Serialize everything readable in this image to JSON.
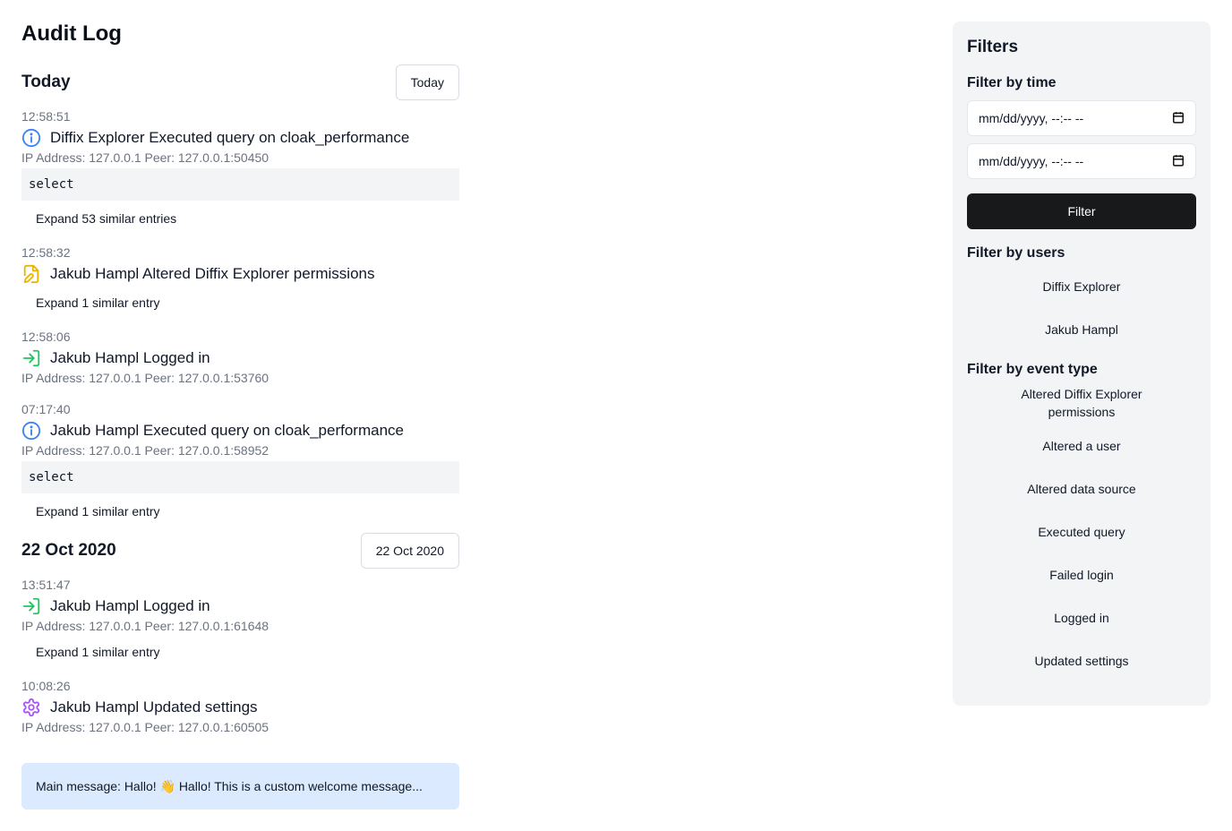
{
  "page": {
    "title": "Audit Log"
  },
  "groups": [
    {
      "title": "Today",
      "button_label": "Today",
      "entries": [
        {
          "time": "12:58:51",
          "icon": "info-icon",
          "text": "Diffix Explorer Executed query on cloak_performance",
          "meta": "IP Address: 127.0.0.1 Peer: 127.0.0.1:50450",
          "code": "select",
          "expand": "Expand 53 similar entries"
        },
        {
          "time": "12:58:32",
          "icon": "file-edit-icon",
          "text": "Jakub Hampl Altered Diffix Explorer permissions",
          "expand": "Expand 1 similar entry"
        },
        {
          "time": "12:58:06",
          "icon": "login-icon",
          "text": "Jakub Hampl Logged in",
          "meta": "IP Address: 127.0.0.1 Peer: 127.0.0.1:53760"
        },
        {
          "time": "07:17:40",
          "icon": "info-icon",
          "text": "Jakub Hampl Executed query on cloak_performance",
          "meta": "IP Address: 127.0.0.1 Peer: 127.0.0.1:58952",
          "code": "select",
          "expand": "Expand 1 similar entry"
        }
      ]
    },
    {
      "title": "22 Oct 2020",
      "button_label": "22 Oct 2020",
      "entries": [
        {
          "time": "13:51:47",
          "icon": "login-icon",
          "text": "Jakub Hampl Logged in",
          "meta": "IP Address: 127.0.0.1 Peer: 127.0.0.1:61648",
          "expand": "Expand 1 similar entry"
        },
        {
          "time": "10:08:26",
          "icon": "gear-icon",
          "text": "Jakub Hampl Updated settings",
          "meta": "IP Address: 127.0.0.1 Peer: 127.0.0.1:60505"
        }
      ]
    }
  ],
  "message": "Main message: Hallo! 👋 Hallo! This is a custom welcome message...",
  "filters": {
    "title": "Filters",
    "time_heading": "Filter by time",
    "date_placeholder_1": "mm/dd/yyyy, --:-- --",
    "date_placeholder_2": "mm/dd/yyyy, --:-- --",
    "filter_button": "Filter",
    "users_heading": "Filter by users",
    "users": [
      "Diffix Explorer",
      "Jakub Hampl"
    ],
    "event_heading": "Filter by event type",
    "events": [
      "Altered Diffix Explorer permissions",
      "Altered a user",
      "Altered data source",
      "Executed query",
      "Failed login",
      "Logged in",
      "Updated settings"
    ]
  },
  "colors": {
    "info": "#3b82f6",
    "file_edit": "#eab308",
    "login": "#22c55e",
    "gear": "#a855f7",
    "message_bg": "#dbeafe"
  }
}
